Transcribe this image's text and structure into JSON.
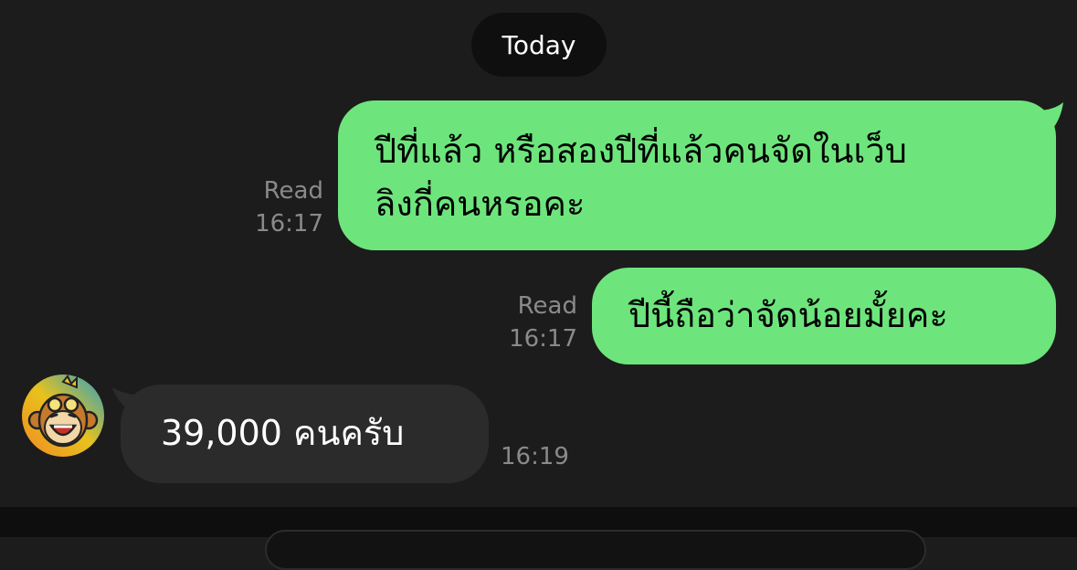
{
  "date_separator": "Today",
  "messages": [
    {
      "direction": "outgoing",
      "lines": [
        "ปีที่แล้ว หรือสองปีที่แล้วคนจัดในเว็บ",
        "ลิงกี่คนหรอคะ"
      ],
      "status": "Read",
      "time": "16:17"
    },
    {
      "direction": "outgoing",
      "lines": [
        "ปีนี้ถือว่าจัดน้อยมั้ยคะ"
      ],
      "status": "Read",
      "time": "16:17"
    },
    {
      "direction": "incoming",
      "avatar_icon": "monkey-avatar-icon",
      "text": "39,000 คนครับ",
      "time": "16:19"
    }
  ],
  "colors": {
    "outgoing_bubble": "#6de57c",
    "incoming_bubble": "#2b2b2b",
    "background": "#1c1c1c",
    "meta_text": "#8a8a8a"
  }
}
